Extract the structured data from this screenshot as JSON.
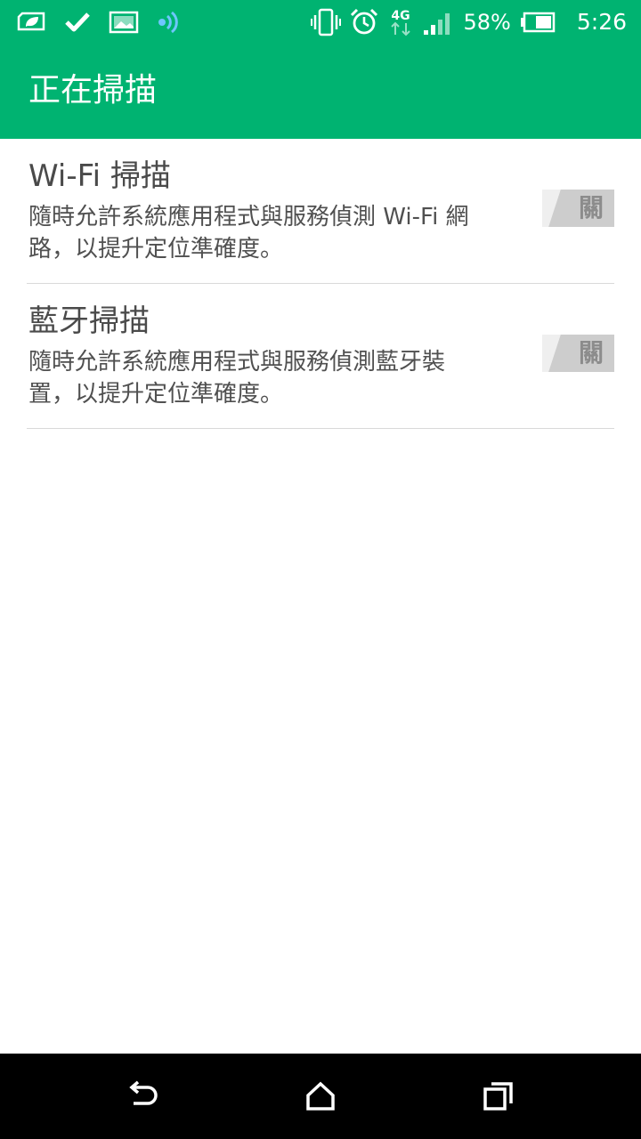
{
  "status_bar": {
    "battery_percent": "58%",
    "time": "5:26",
    "network": "4G"
  },
  "app_bar": {
    "title": "正在掃描"
  },
  "settings": [
    {
      "title": "Wi-Fi 掃描",
      "description_line1": "隨時允許系統應用程式與服務偵測 Wi-Fi 網",
      "description_line2": "路，以提升定位準確度。",
      "toggle_label": "關"
    },
    {
      "title": "藍牙掃描",
      "description_line1": "隨時允許系統應用程式與服務偵測藍牙裝",
      "description_line2": "置，以提升定位準確度。",
      "toggle_label": "關"
    }
  ],
  "icons": {
    "status_left": [
      "eco-mode-icon",
      "checkmark-icon",
      "gallery-icon",
      "nfc-icon"
    ],
    "status_right": [
      "vibrate-icon",
      "alarm-icon",
      "network-4g-icon",
      "signal-icon",
      "battery-icon"
    ],
    "nav": [
      "back-icon",
      "home-icon",
      "recents-icon"
    ]
  },
  "colors": {
    "accent": "#00b371",
    "nfc_icon": "#6ec6ff",
    "nav_background": "#000000"
  }
}
